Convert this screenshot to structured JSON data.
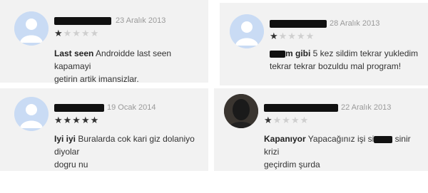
{
  "reviews": [
    {
      "date": "23 Aralık 2013",
      "rating": 1,
      "title": "Last seen",
      "body": "Androidde last seen kapamayi getirin artik imansizlar.",
      "line1_rest": " Androidde last seen kapamayi",
      "line2": "getirin artik imansizlar."
    },
    {
      "date": "28 Aralık 2013",
      "rating": 1,
      "title_rest": "m gibi",
      "line1_rest": " 5 kez sildim tekrar yukledim",
      "line2": "tekrar tekrar bozuldu mal program!"
    },
    {
      "date": "19 Ocak 2014",
      "rating": 5,
      "title": "Iyi iyi",
      "line1_rest": " Buralarda cok kari giz dolaniyo diyolar",
      "line2": "dogru nu"
    },
    {
      "date": "22 Aralık 2013",
      "rating": 1,
      "title": "Kapanıyor",
      "line1_a": " Yapacağınız işi si",
      "line1_b": " sinir krizi",
      "line2": "geçirdim şurda"
    }
  ],
  "colors": {
    "panel_bg": "#f2f2f2",
    "avatar_bg": "#c9dbf4",
    "star_on": "#333333",
    "star_off": "#cfcfcf",
    "date_text": "#9a9a9a"
  },
  "icons": {
    "avatar": "default-user-icon",
    "star": "star-icon"
  }
}
